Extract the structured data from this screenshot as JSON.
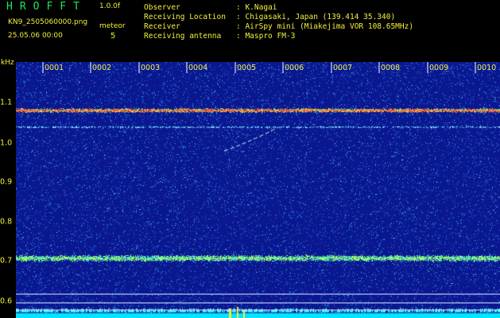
{
  "header": {
    "app_title": "HROFFT",
    "version": "1.0.0f",
    "filename": "KN9_2505060000.png",
    "timestamp": "25.05.06 00:00",
    "mode_label": "meteor",
    "mode_value": "5"
  },
  "info": {
    "observer_label": "Observer",
    "observer_value": ": K.Nagai",
    "location_label": "Receiving Location",
    "location_value": ": Chigasaki, Japan (139.414 35.340)",
    "receiver_label": "Receiver",
    "receiver_value": ": AirSpy mini (Miakejima VOR 108.65MHz)",
    "antenna_label": "Receiving antenna",
    "antenna_value": ": Maspro FM-3"
  },
  "axis": {
    "unit": "kHz",
    "y_ticks": [
      "1.1",
      "1.0",
      "0.9",
      "0.8",
      "0.7",
      "0.6"
    ],
    "x_ticks": [
      "0001",
      "0002",
      "0003",
      "0004",
      "0005",
      "0006",
      "0007",
      "0008",
      "0009",
      "0010"
    ]
  },
  "colors": {
    "background": "#000000",
    "plot_background": "#0a1890",
    "label_yellow": "#f4ef3a",
    "title_green": "#1ee85a",
    "noise_cyan": "#00e6ff"
  }
}
